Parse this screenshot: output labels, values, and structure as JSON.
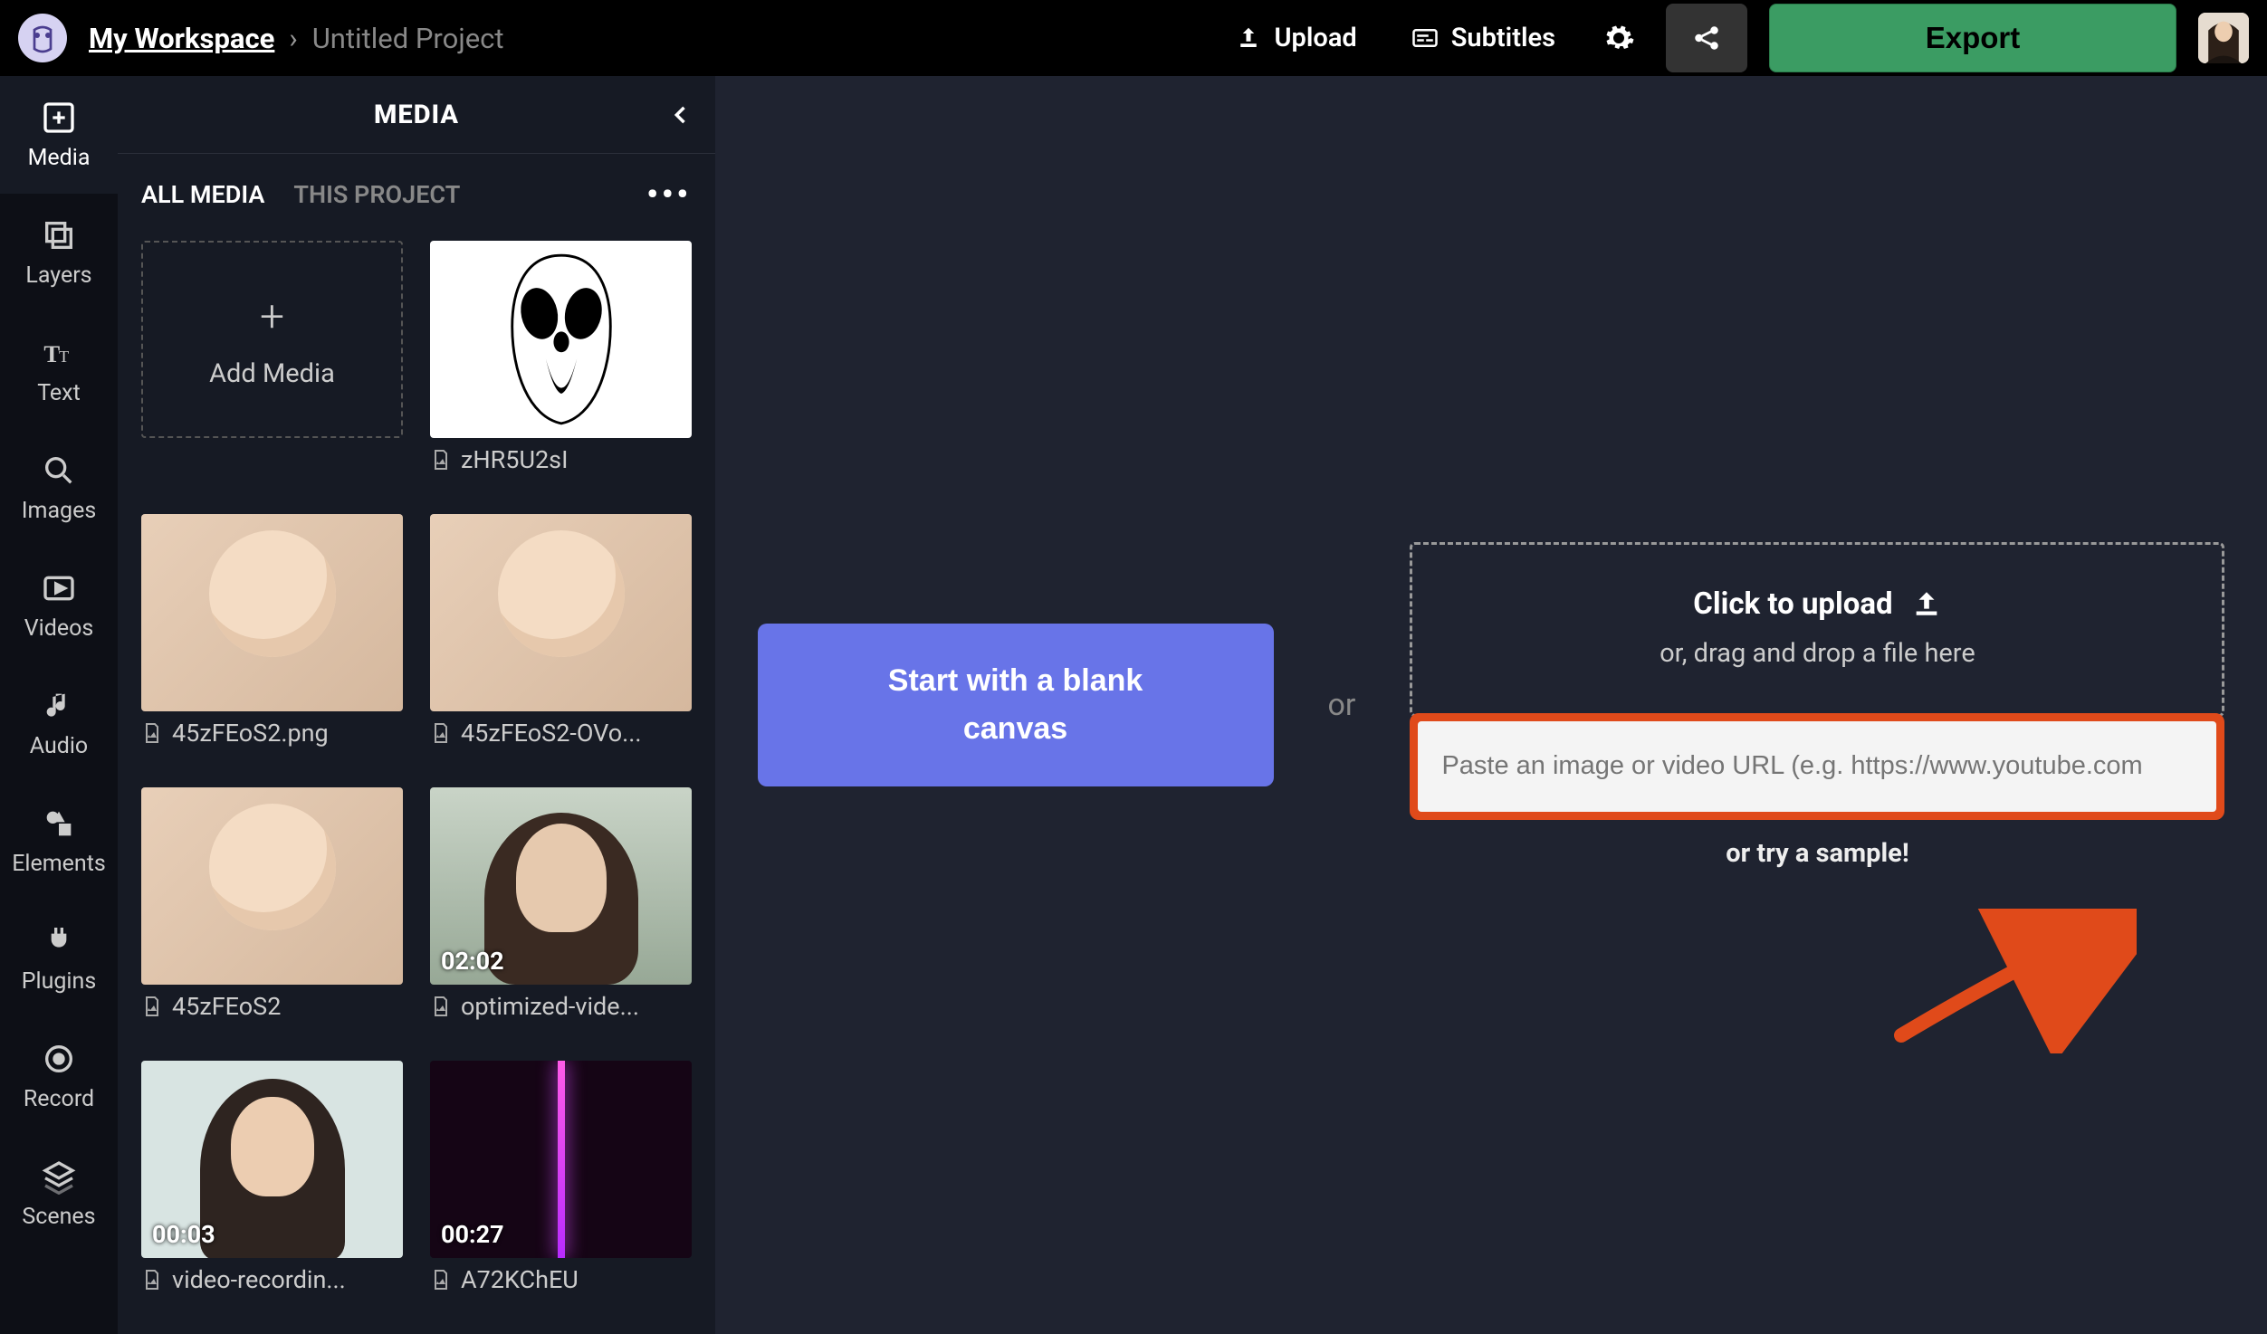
{
  "header": {
    "workspace": "My Workspace",
    "project": "Untitled Project",
    "upload": "Upload",
    "subtitles": "Subtitles",
    "export": "Export"
  },
  "rail": [
    {
      "id": "media",
      "label": "Media",
      "icon": "add-box-icon"
    },
    {
      "id": "layers",
      "label": "Layers",
      "icon": "layers-icon"
    },
    {
      "id": "text",
      "label": "Text",
      "icon": "text-icon"
    },
    {
      "id": "images",
      "label": "Images",
      "icon": "search-icon"
    },
    {
      "id": "videos",
      "label": "Videos",
      "icon": "play-box-icon"
    },
    {
      "id": "audio",
      "label": "Audio",
      "icon": "music-note-icon"
    },
    {
      "id": "elements",
      "label": "Elements",
      "icon": "shapes-icon"
    },
    {
      "id": "plugins",
      "label": "Plugins",
      "icon": "plug-icon"
    },
    {
      "id": "record",
      "label": "Record",
      "icon": "record-icon"
    },
    {
      "id": "scenes",
      "label": "Scenes",
      "icon": "stack-icon"
    }
  ],
  "panel": {
    "title": "MEDIA",
    "tabs": {
      "all": "ALL MEDIA",
      "project": "THIS PROJECT"
    },
    "add_media": "Add Media",
    "items": [
      {
        "name": "zHR5U2sI",
        "art": "ghost-face",
        "duration": ""
      },
      {
        "name": "45zFEoS2.png",
        "art": "baby",
        "duration": ""
      },
      {
        "name": "45zFEoS2-OVo...",
        "art": "baby",
        "duration": ""
      },
      {
        "name": "45zFEoS2",
        "art": "baby",
        "duration": ""
      },
      {
        "name": "optimized-vide...",
        "art": "woman1",
        "duration": "02:02"
      },
      {
        "name": "video-recordin...",
        "art": "woman2",
        "duration": "00:03"
      },
      {
        "name": "A72KChEU",
        "art": "abstract",
        "duration": "00:27"
      }
    ]
  },
  "canvas": {
    "blank_canvas": "Start with a blank\ncanvas",
    "or": "or",
    "upload_headline": "Click to upload",
    "upload_sub": "or, drag and drop a file here",
    "url_placeholder": "Paste an image or video URL (e.g. https://www.youtube.com",
    "try_sample": "or try a sample!"
  }
}
